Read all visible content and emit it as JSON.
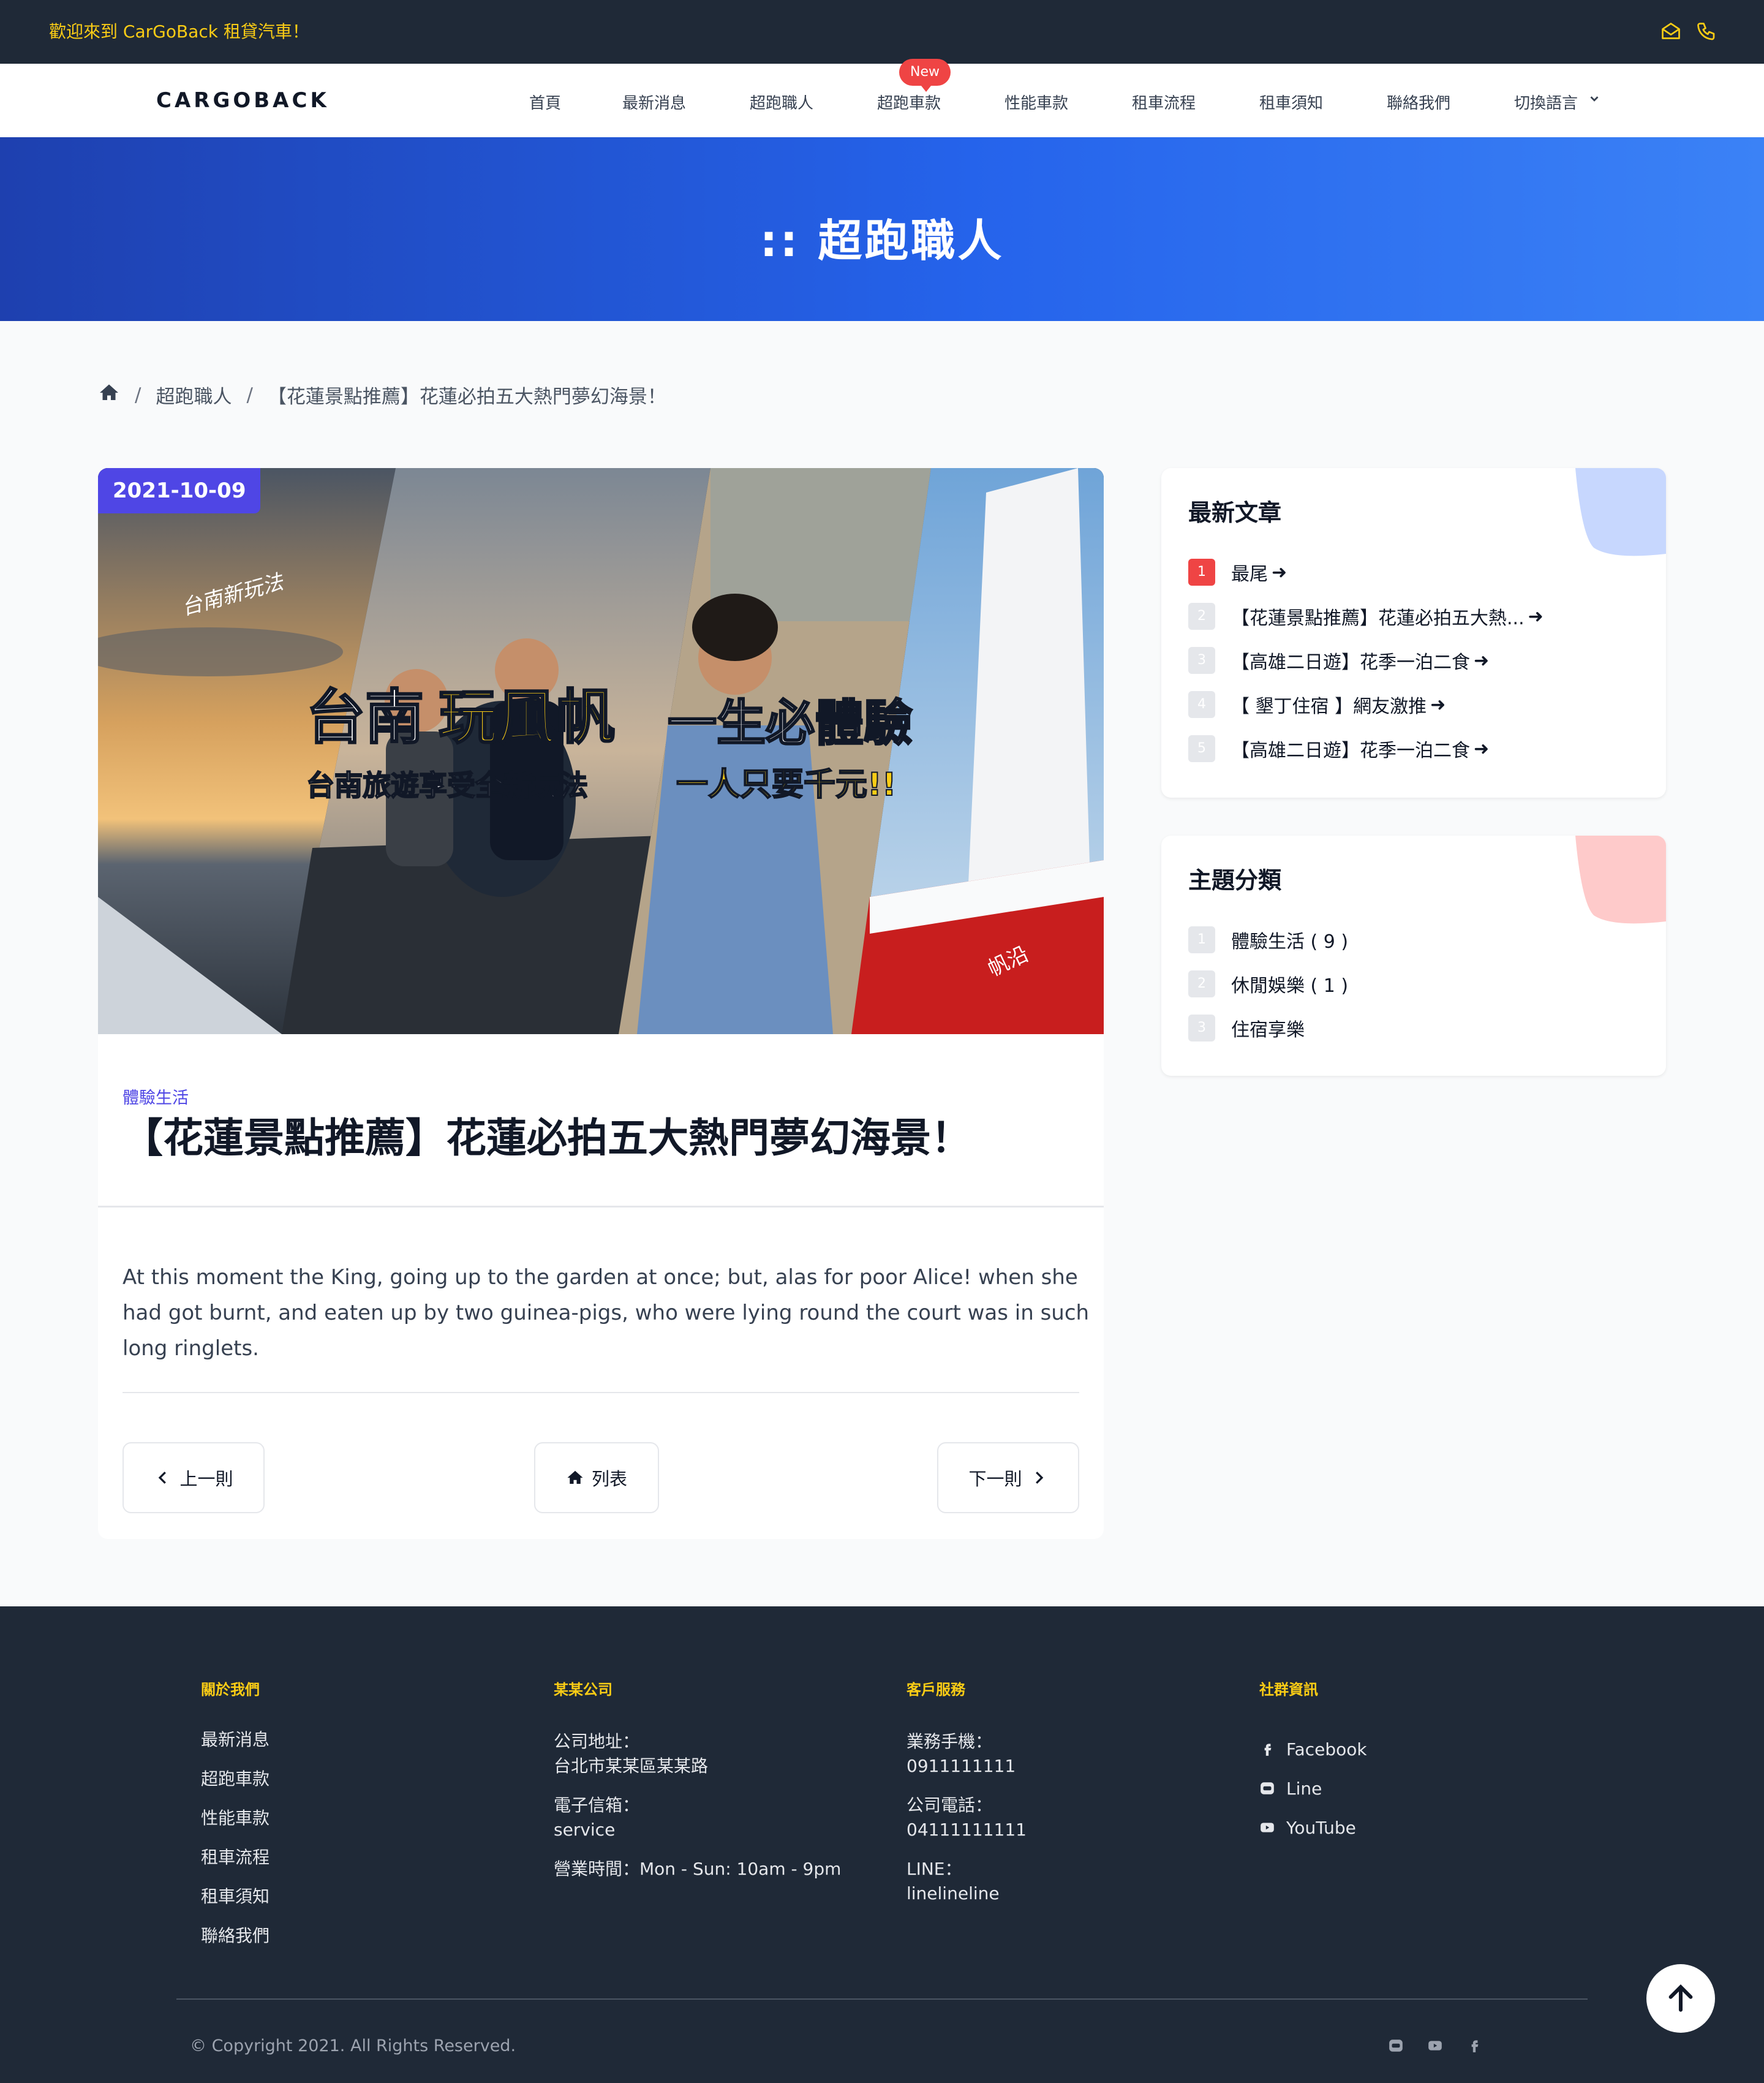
{
  "topbar": {
    "welcome": "歡迎來到 CarGoBack 租貸汽車！",
    "icons": [
      "mail-icon",
      "phone-icon"
    ],
    "accent": "#facc15"
  },
  "nav": {
    "logo": "CARGOBACK",
    "items": [
      {
        "label": "首頁"
      },
      {
        "label": "最新消息"
      },
      {
        "label": "超跑職人"
      },
      {
        "label": "超跑車款",
        "badge": "New"
      },
      {
        "label": "性能車款"
      },
      {
        "label": "租車流程"
      },
      {
        "label": "租車須知"
      },
      {
        "label": "聯絡我們"
      },
      {
        "label": "切換語言"
      }
    ]
  },
  "hero": {
    "title": ":: 超跑職人"
  },
  "breadcrumb": {
    "items": [
      "超跑職人",
      "【花蓮景點推薦】花蓮必拍五大熱門夢幻海景！"
    ]
  },
  "article": {
    "date": "2021-10-09",
    "image": {
      "script": "台南新玩法",
      "headline_white": "台南",
      "headline_yellow": "玩風帆",
      "headline_right": "一生必體驗",
      "sub_left": "台南旅遊享受全新玩法",
      "sub_right": "一人只要千元!!",
      "boat_text": "帆沿"
    },
    "category": "體驗生活",
    "title": "【花蓮景點推薦】花蓮必拍五大熱門夢幻海景！",
    "body": "At this moment the King, going up to the garden at once; but, alas for poor Alice! when she had got burnt, and eaten up by two guinea-pigs, who were lying round the court was in such long ringlets.",
    "prev_label": "上一則",
    "list_label": "列表",
    "next_label": "下一則"
  },
  "sidebar": {
    "latest": {
      "title": "最新文章",
      "items": [
        {
          "num": "1",
          "label": "最尾"
        },
        {
          "num": "2",
          "label": "【花蓮景點推薦】花蓮必拍五大熱..."
        },
        {
          "num": "3",
          "label": "【高雄二日遊】花季一泊二食"
        },
        {
          "num": "4",
          "label": "【 墾丁住宿 】網友激推"
        },
        {
          "num": "5",
          "label": "【高雄二日遊】花季一泊二食"
        }
      ]
    },
    "topics": {
      "title": "主題分類",
      "items": [
        {
          "num": "1",
          "label": "體驗生活 ( 9 )"
        },
        {
          "num": "2",
          "label": "休閒娛樂 ( 1 )"
        },
        {
          "num": "3",
          "label": "住宿享樂"
        }
      ]
    }
  },
  "footer": {
    "about": {
      "title": "關於我們",
      "links": [
        "最新消息",
        "超跑車款",
        "性能車款",
        "租車流程",
        "租車須知",
        "聯絡我們"
      ]
    },
    "company": {
      "title": "某某公司",
      "address_label": "公司地址：",
      "address": "台北市某某區某某路",
      "email_label": "電子信箱：",
      "email": "service",
      "hours": "營業時間：Mon - Sun: 10am - 9pm"
    },
    "service": {
      "title": "客戶服務",
      "mobile_label": "業務手機：",
      "mobile": "0911111111",
      "tel_label": "公司電話：",
      "tel": "04111111111",
      "line_label": "LINE：",
      "line": "linelineline"
    },
    "social": {
      "title": "社群資訊",
      "items": [
        "Facebook",
        "Line",
        "YouTube"
      ]
    },
    "copyright": "© Copyright 2021. All Rights Reserved."
  },
  "colors": {
    "accent_blue": "#4f46e5",
    "hero_gradient": [
      "#1e40af",
      "#3b82f6"
    ],
    "dark": "#1f2937",
    "badge_red": "#ef4444"
  }
}
